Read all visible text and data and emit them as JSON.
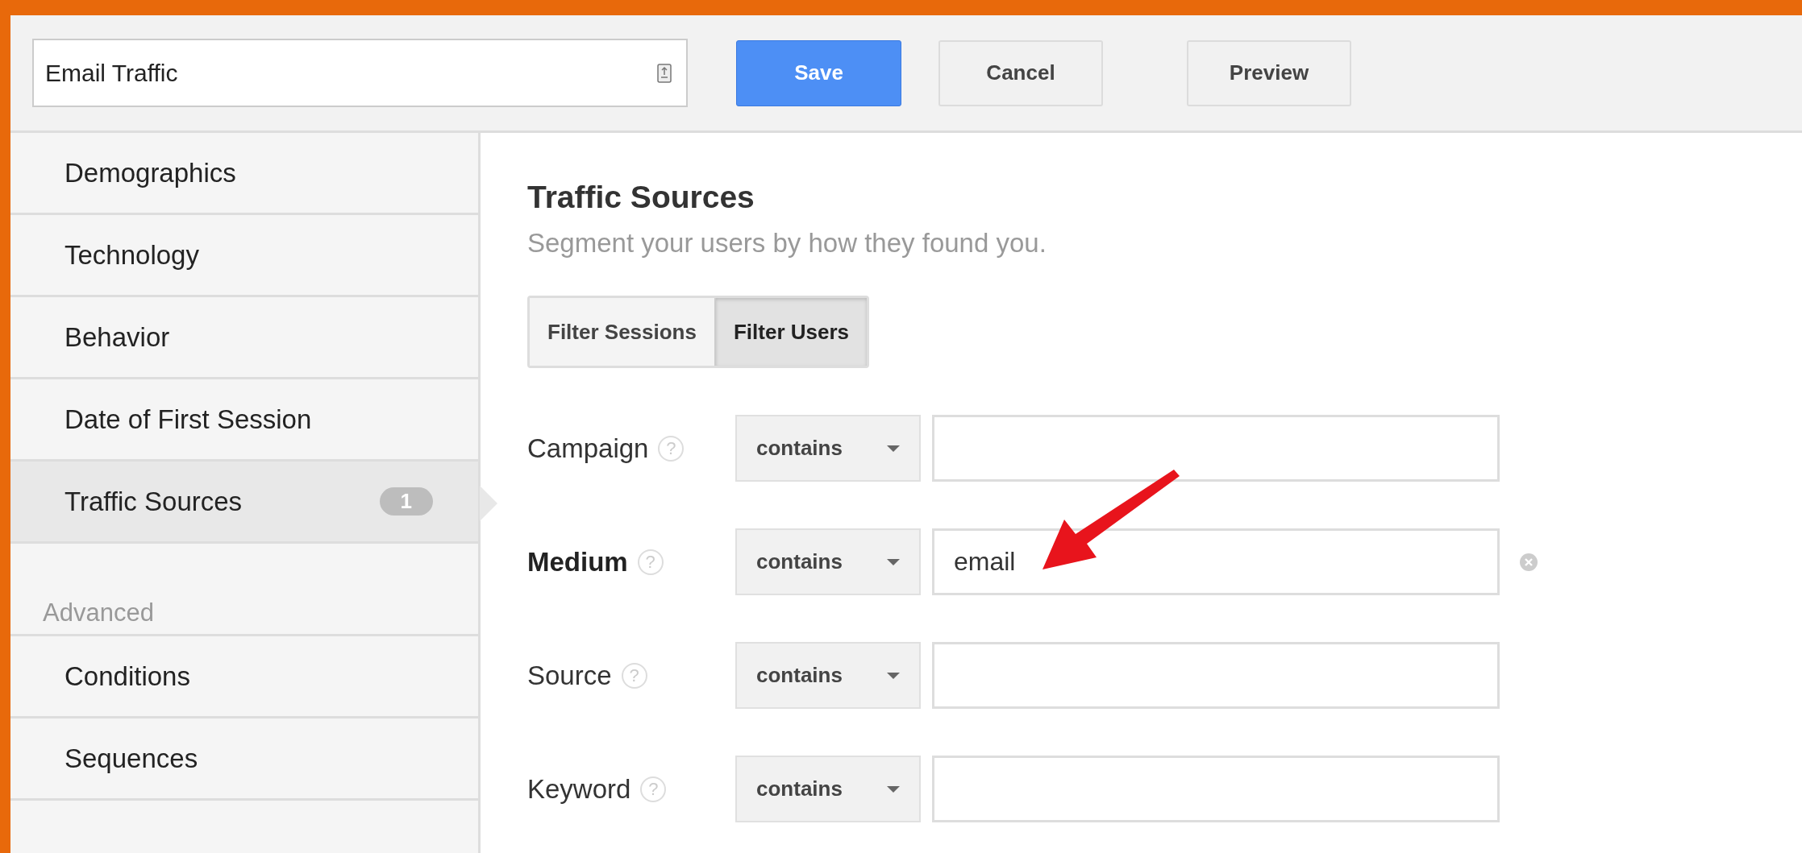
{
  "segment_name": {
    "value": "Email Traffic"
  },
  "buttons": [
    {
      "label": "Save",
      "kind": "primary"
    },
    {
      "label": "Cancel",
      "kind": "default"
    },
    {
      "label": "Preview",
      "kind": "default"
    }
  ],
  "sidebar": {
    "items": [
      {
        "label": "Demographics",
        "selected": false
      },
      {
        "label": "Technology",
        "selected": false
      },
      {
        "label": "Behavior",
        "selected": false
      },
      {
        "label": "Date of First Session",
        "selected": false
      },
      {
        "label": "Traffic Sources",
        "selected": true,
        "badge": "1"
      }
    ],
    "section_label": "Advanced",
    "advanced_items": [
      {
        "label": "Conditions",
        "selected": false
      },
      {
        "label": "Sequences",
        "selected": false
      }
    ]
  },
  "panel": {
    "title": "Traffic Sources",
    "subtitle": "Segment your users by how they found you.",
    "filter_tabs": [
      {
        "label": "Filter Sessions",
        "selected": false
      },
      {
        "label": "Filter Users",
        "selected": true
      }
    ],
    "rows": [
      {
        "label": "Campaign",
        "help": "?",
        "operator": "contains",
        "active": false
      },
      {
        "label": "Medium",
        "help": "?",
        "operator": "contains",
        "value": "email",
        "active": true
      },
      {
        "label": "Source",
        "help": "?",
        "operator": "contains",
        "active": false
      },
      {
        "label": "Keyword",
        "help": "?",
        "operator": "contains",
        "active": false
      }
    ],
    "annotations": [
      {
        "kind": "arrow"
      }
    ]
  }
}
